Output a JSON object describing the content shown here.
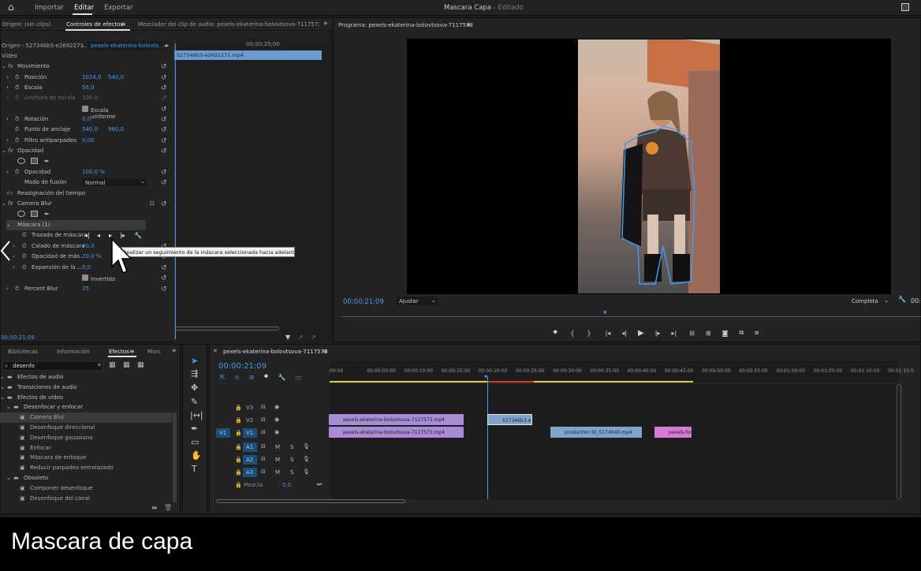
{
  "topbar": {
    "home": "home-icon",
    "tabs": [
      "Importar",
      "Editar",
      "Exportar"
    ],
    "title": "Mascara Capa",
    "status": " - Editado"
  },
  "source_panel": {
    "origin": "Origen: (sin clips)",
    "tab_active": "Controles de efectos",
    "tab_mixer": "Mezclador del clip de audio: pexels-ekaterina-bolovtsova-7117573",
    "clip_select": "Origen - 527346b3-e2692271...",
    "sequence_select": "pexels-ekaterina-bolovts...",
    "timecode_head": "00;00;25;00",
    "clip_bar": "527346b3-e2692271.mp4"
  },
  "effect_controls": {
    "video": "Vídeo",
    "movimiento": "Movimiento",
    "posicion": {
      "label": "Posición",
      "x": "1024,0",
      "y": "540,0"
    },
    "escala": {
      "label": "Escala",
      "value": "56,0"
    },
    "anchura": {
      "label": "Anchura de escala",
      "value": "100,0"
    },
    "uniforme": "Escala uniforme",
    "rotacion": {
      "label": "Rotación",
      "value": "0,0"
    },
    "anclaje": {
      "label": "Punto de anclaje",
      "x": "540,0",
      "y": "960,0"
    },
    "antiparpadeo": {
      "label": "Filtro antiparpadeo",
      "value": "0,00"
    },
    "opacidad_group": "Opacidad",
    "opacidad": {
      "label": "Opacidad",
      "value": "100,0 %"
    },
    "fusion": {
      "label": "Modo de fusión",
      "value": "Normal"
    },
    "reasignacion": "Reasignación del tiempo",
    "camera_blur": "Camera Blur",
    "mascara": "Máscara (1)",
    "trazado": "Trazado de máscara",
    "calado": {
      "label": "Calado de máscara",
      "value": "40,0"
    },
    "opacidad_mascara": {
      "label": "Opacidad de más...",
      "value": "70,0 %"
    },
    "expansion": {
      "label": "Expansión de la ...",
      "value": "0,0"
    },
    "invertido": "Invertido",
    "percent_blur": {
      "label": "Percent Blur",
      "value": "25"
    },
    "tooltip": "Realizar un seguimiento de la máscara seleccionada hacia adelante",
    "timecode": "00;00;21;09"
  },
  "program": {
    "title": "Programa: pexels-ekaterina-bolovtsova-7117573",
    "timecode": "00;00;21;09",
    "fit": "Ajustar",
    "quality": "Completa",
    "right_tc": "00:"
  },
  "effects_panel": {
    "tabs": [
      "Bibliotecas",
      "Información",
      "Efectos",
      "Marc"
    ],
    "search": "desenfo",
    "items": [
      {
        "label": "Efectos de audio",
        "level": 0,
        "type": "folder"
      },
      {
        "label": "Transiciones de audio",
        "level": 0,
        "type": "folder"
      },
      {
        "label": "Efectos de vídeo",
        "level": 0,
        "type": "folder"
      },
      {
        "label": "Desenfocar y enfocar",
        "level": 1,
        "type": "folder"
      },
      {
        "label": "Camera Blur",
        "level": 2,
        "type": "effect",
        "selected": true
      },
      {
        "label": "Desenfoque direccional",
        "level": 2,
        "type": "effect"
      },
      {
        "label": "Desenfoque gaussiano",
        "level": 2,
        "type": "effect"
      },
      {
        "label": "Enfocar",
        "level": 2,
        "type": "effect"
      },
      {
        "label": "Máscara de enfoque",
        "level": 2,
        "type": "effect"
      },
      {
        "label": "Reducir parpadeo entrelazado",
        "level": 2,
        "type": "effect"
      },
      {
        "label": "Obsoleto",
        "level": 1,
        "type": "folder"
      },
      {
        "label": "Componer desenfoque",
        "level": 2,
        "type": "effect"
      },
      {
        "label": "Desenfoque del canal",
        "level": 2,
        "type": "effect"
      }
    ]
  },
  "timeline": {
    "tab": "pexels-ekaterina-bolovtsova-7117573",
    "timecode": "00:00:21:09",
    "ruler": [
      "00:00",
      "00:00:05:00",
      "00:00:10:00",
      "00:00:15:00",
      "00:00:20:00",
      "00:00:25:00",
      "00:00:30:00",
      "00:00:35:00",
      "00:00:40:00",
      "00:00:45:00",
      "00:00:50:00",
      "00:00:55:00",
      "00:01:00:00",
      "00:01:05:00",
      "00:01:10:00",
      "00:01:15:0"
    ],
    "tracks": {
      "v3": "V3",
      "v2": "V2",
      "v1": "V1",
      "v1src": "V1",
      "a1": "A1",
      "a2": "A2",
      "a3": "A3",
      "mix": "Mezcla",
      "mix_val": "0,0",
      "m": "M",
      "s": "S"
    },
    "clips": {
      "v2a": "pexels-ekaterina-bolovtsova-7117573.mp4",
      "v2b": "527346b3-e2",
      "v1a": "pexels-ekaterina-bolovtsova-7117573.mp4",
      "v1b": "production ID_5174040.mp4",
      "v1c": "pexels-for"
    }
  },
  "caption": "Mascara de capa",
  "colors": {
    "accent": "#3f9bf5",
    "clip_purple": "#a98ad6",
    "clip_blue": "#7ea3cc",
    "clip_pink": "#d77ad5"
  }
}
